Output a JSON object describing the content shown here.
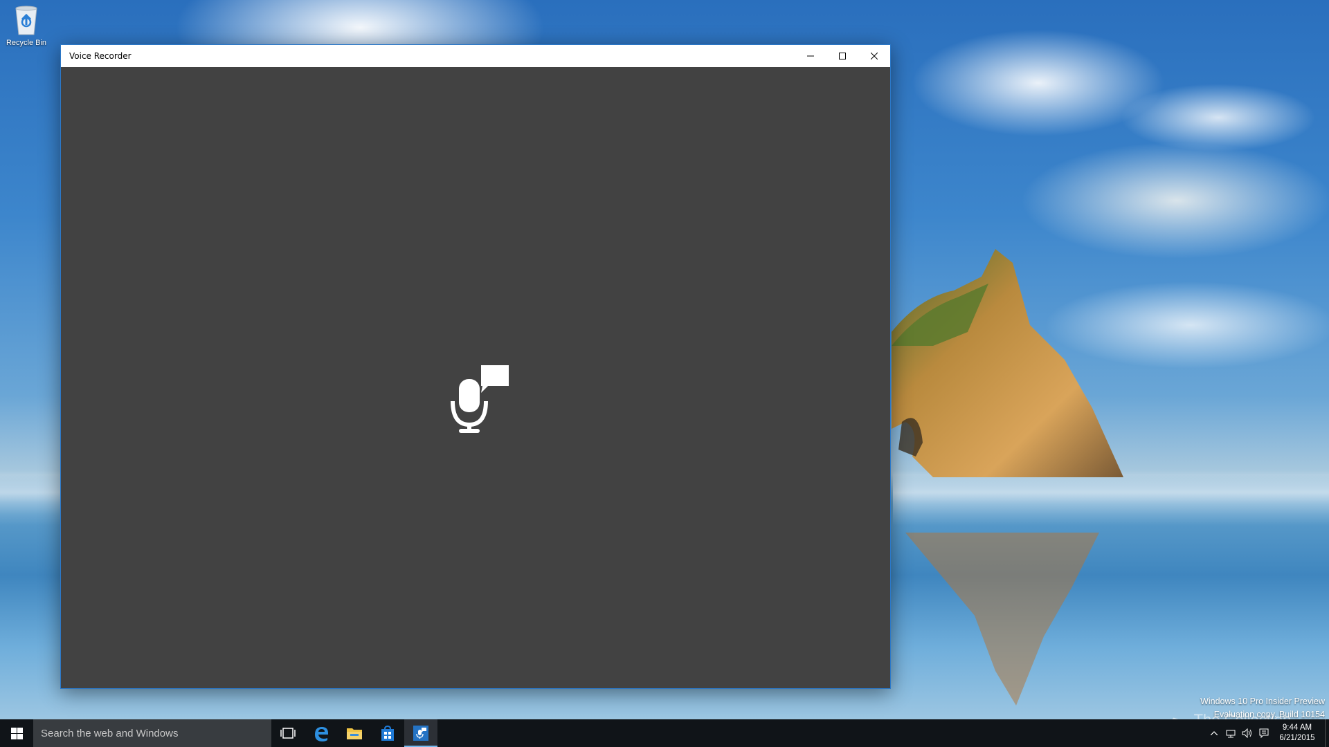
{
  "desktop": {
    "icons": [
      {
        "label": "Recycle Bin",
        "icon": "recycle-bin-icon"
      }
    ]
  },
  "window": {
    "title": "Voice Recorder",
    "controls": {
      "minimize": "minimize-icon",
      "maximize": "maximize-icon",
      "close": "close-icon"
    },
    "content": {
      "background": "#424242",
      "splash_icon": "voice-recorder-icon"
    }
  },
  "watermark": {
    "line1": "Windows 10 Pro Insider Preview",
    "line2": "Evaluation copy. Build 10154"
  },
  "site_logo": {
    "text": "The Collection Book"
  },
  "taskbar": {
    "search_placeholder": "Search the web and Windows",
    "pinned": [
      {
        "name": "task-view-icon"
      },
      {
        "name": "edge-icon"
      },
      {
        "name": "file-explorer-icon"
      },
      {
        "name": "store-icon"
      },
      {
        "name": "voice-recorder-icon",
        "active": true
      }
    ],
    "clock": {
      "time": "9:44 AM",
      "date": "6/21/2015"
    },
    "colors": {
      "taskbar_bg": "#101418",
      "accent": "#76b9ed"
    }
  }
}
